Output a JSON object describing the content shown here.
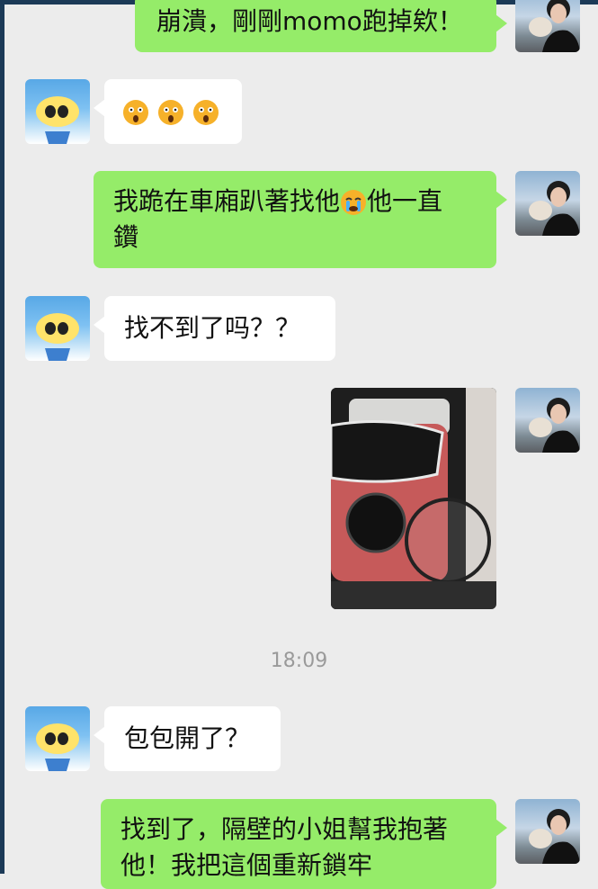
{
  "messages": [
    {
      "sender": "me",
      "text": "崩潰，剛剛momo跑掉欸！"
    },
    {
      "sender": "friend",
      "emoji": [
        "astonished-face",
        "astonished-face",
        "astonished-face"
      ]
    },
    {
      "sender": "me",
      "text_line1": "我跪在車廂趴著找他",
      "text_line2": "他一直",
      "text_line3": "鑽",
      "emoji": "crying-face"
    },
    {
      "sender": "friend",
      "text": "找不到了吗？？"
    },
    {
      "sender": "me",
      "type": "photo",
      "description_icon": "pet-carrier-photo"
    },
    {
      "timestamp": "18:09"
    },
    {
      "sender": "friend",
      "text": "包包開了？"
    },
    {
      "sender": "me",
      "text_line1": "找到了，隔壁的小姐幫我抱著",
      "text_line2": "他！我把這個重新鎖牢"
    }
  ],
  "colors": {
    "me_bubble": "#95ec69",
    "friend_bubble": "#ffffff",
    "background": "#ececec",
    "accent_bar": "#1c3a57"
  }
}
